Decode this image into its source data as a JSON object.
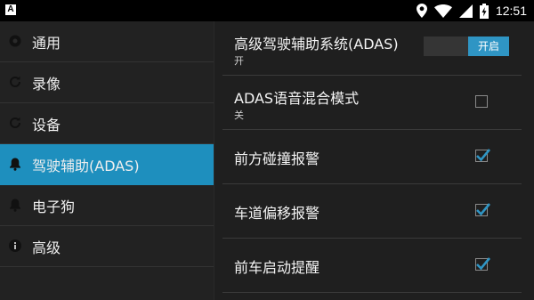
{
  "status_bar": {
    "app_icon_letter": "A",
    "time": "12:51",
    "icons": [
      "location-icon",
      "wifi-icon",
      "cell-signal-icon",
      "battery-charging-icon"
    ]
  },
  "sidebar": {
    "items": [
      {
        "label": "通用",
        "icon": "gear-icon",
        "active": false
      },
      {
        "label": "录像",
        "icon": "refresh-icon",
        "active": false
      },
      {
        "label": "设备",
        "icon": "refresh-icon",
        "active": false
      },
      {
        "label": "驾驶辅助(ADAS)",
        "icon": "bell-icon",
        "active": true
      },
      {
        "label": "电子狗",
        "icon": "bell-icon",
        "active": false
      },
      {
        "label": "高级",
        "icon": "info-icon",
        "active": false
      }
    ]
  },
  "settings": {
    "adas": {
      "title": "高级驾驶辅助系统(ADAS)",
      "summary": "开",
      "switch_label": "开启",
      "on": true
    },
    "voice_mix": {
      "title": "ADAS语音混合模式",
      "summary": "关",
      "checked": false
    },
    "forward_collision": {
      "title": "前方碰撞报警",
      "checked": true
    },
    "lane_departure": {
      "title": "车道偏移报警",
      "checked": true
    },
    "front_car_start": {
      "title": "前车启动提醒",
      "checked": true
    }
  },
  "colors": {
    "accent": "#1e8fbe",
    "switch_on": "#2f95c4",
    "background": "#1f1f1f"
  }
}
